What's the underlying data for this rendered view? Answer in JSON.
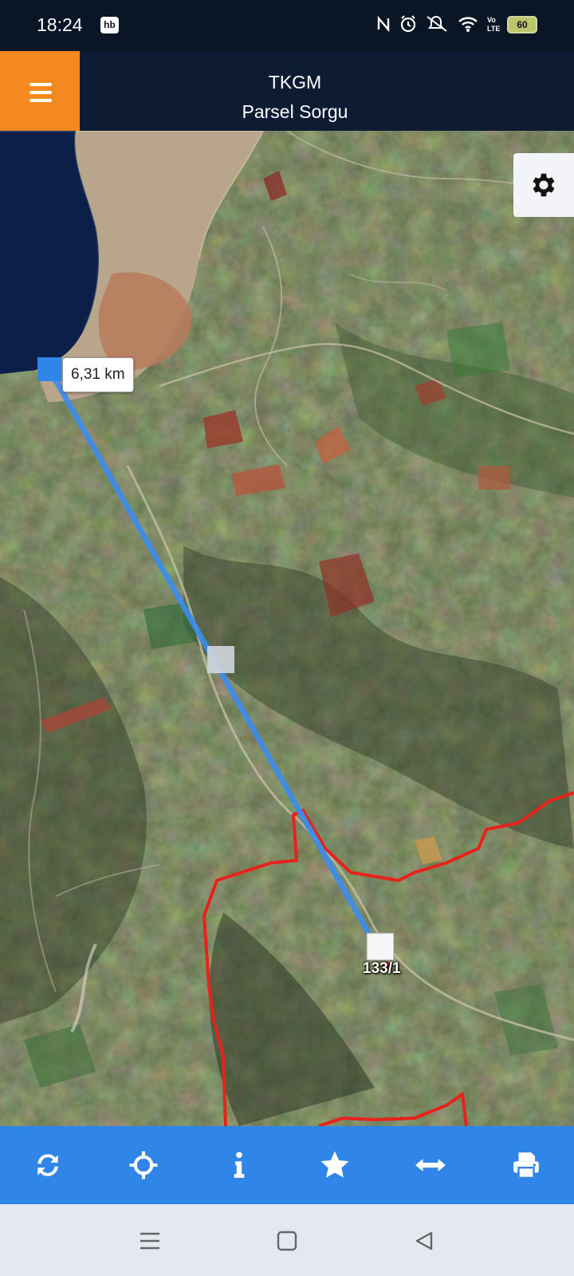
{
  "status_bar": {
    "time": "18:24",
    "hb_badge": "hb",
    "battery": "60"
  },
  "header": {
    "title": "TKGM",
    "subtitle": "Parsel Sorgu"
  },
  "map": {
    "measure_distance": "6,31 km",
    "parcel_label": "133/1",
    "measure_line_color": "#3b8cf0",
    "boundary_color": "#e8221a"
  },
  "toolbar": {
    "items": [
      "refresh-icon",
      "locate-icon",
      "info-icon",
      "star-icon",
      "measure-icon",
      "print-icon"
    ]
  },
  "colors": {
    "header_bg": "#0d1b33",
    "menu_accent": "#f5891f",
    "toolbar_bg": "#2f86e8"
  }
}
